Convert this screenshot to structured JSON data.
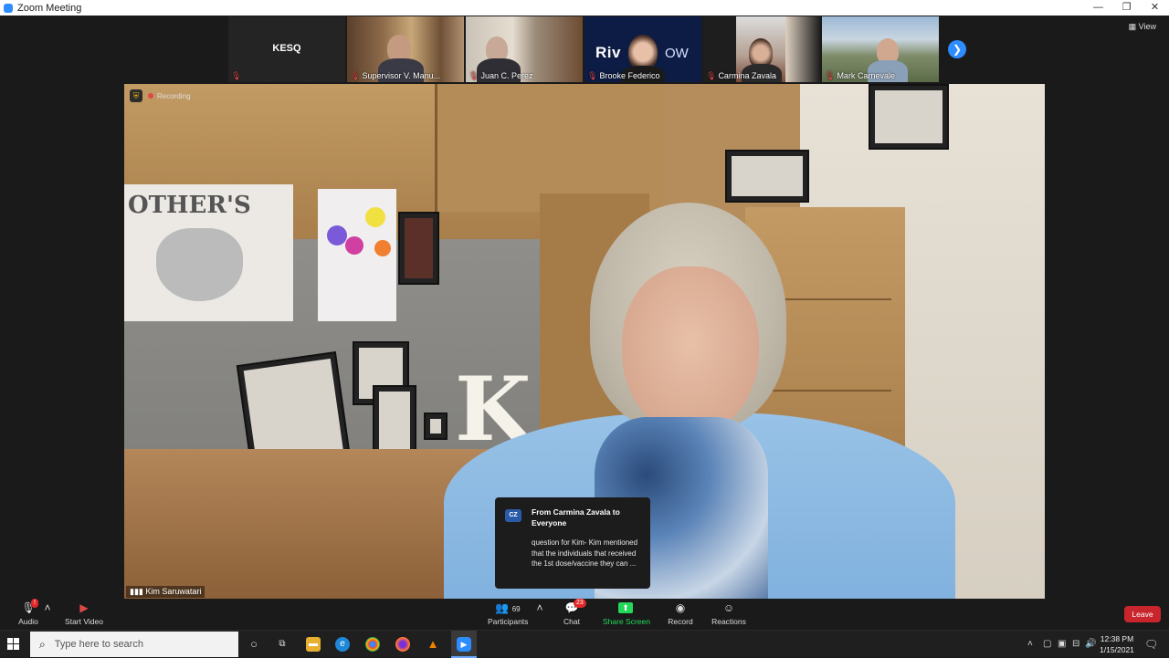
{
  "window": {
    "title": "Zoom Meeting",
    "controls": [
      "—",
      "❐",
      "✕"
    ]
  },
  "gallery": {
    "tiles": [
      {
        "name": "KESQ",
        "type": "label"
      },
      {
        "name": "Supervisor V. Manu...",
        "muted": true
      },
      {
        "name": "Juan C. Perez",
        "muted": true
      },
      {
        "name": "Brooke Federico",
        "muted": true,
        "logo_text_1": "Riv",
        "logo_text_2": "OW"
      },
      {
        "name": "Carmina Zavala",
        "muted": true
      },
      {
        "name": "Mark Carnevale",
        "muted": true
      }
    ],
    "view_label": "View"
  },
  "main_video": {
    "recording_label": "Recording",
    "speaker_name": "Kim Saruwatari",
    "poster_text": "OTHER'S",
    "k_letter": "K"
  },
  "chat_popup": {
    "avatar_initials": "CZ",
    "from": "From Carmina Zavala to Everyone",
    "message": "question for Kim- Kim mentioned that the individuals that received the 1st dose/vaccine they can ..."
  },
  "toolbar": {
    "audio_label": "Audio",
    "start_video_label": "Start Video",
    "participants_label": "Participants",
    "participants_count": "69",
    "chat_label": "Chat",
    "chat_badge": "23",
    "share_screen_label": "Share Screen",
    "record_label": "Record",
    "reactions_label": "Reactions",
    "leave_label": "Leave"
  },
  "taskbar": {
    "search_placeholder": "Type here to search",
    "time": "12:38 PM",
    "date": "1/15/2021"
  },
  "colors": {
    "zoom_blue": "#2d8cff",
    "share_green": "#23d959",
    "leave_red": "#c8252c",
    "mute_red": "#e04848"
  }
}
